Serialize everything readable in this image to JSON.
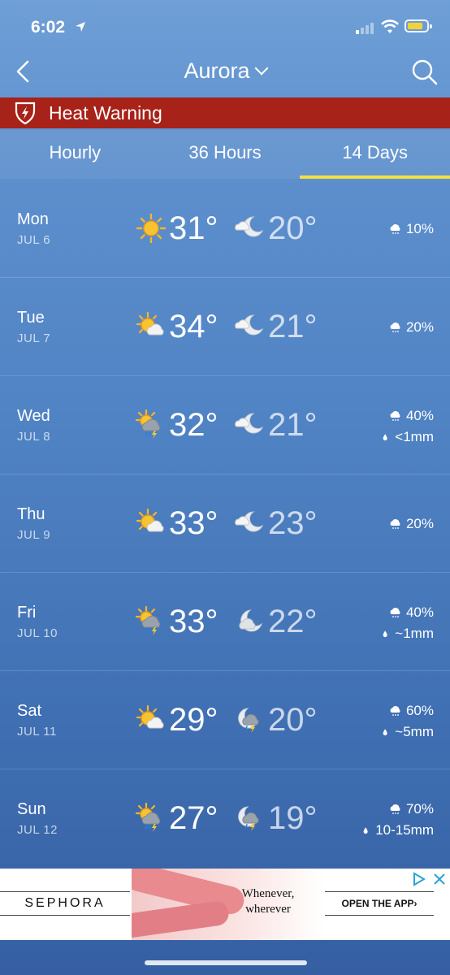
{
  "status_bar": {
    "time": "6:02"
  },
  "header": {
    "city": "Aurora"
  },
  "warning": {
    "text": "Heat Warning"
  },
  "tabs": [
    {
      "label": "Hourly",
      "active": false
    },
    {
      "label": "36 Hours",
      "active": false
    },
    {
      "label": "14 Days",
      "active": true
    }
  ],
  "forecast": [
    {
      "day": "Mon",
      "date": "JUL 6",
      "day_icon": "sunny-icon",
      "high": "31°",
      "night_icon": "moon-cloud-icon",
      "low": "20°",
      "pop": "10%",
      "amount": ""
    },
    {
      "day": "Tue",
      "date": "JUL 7",
      "day_icon": "mostly-sunny-icon",
      "high": "34°",
      "night_icon": "moon-cloud-icon",
      "low": "21°",
      "pop": "20%",
      "amount": ""
    },
    {
      "day": "Wed",
      "date": "JUL 8",
      "day_icon": "sun-thunderstorm-icon",
      "high": "32°",
      "night_icon": "moon-cloud-icon",
      "low": "21°",
      "pop": "40%",
      "amount": "<1mm"
    },
    {
      "day": "Thu",
      "date": "JUL 9",
      "day_icon": "mostly-sunny-icon",
      "high": "33°",
      "night_icon": "moon-cloud-icon",
      "low": "23°",
      "pop": "20%",
      "amount": ""
    },
    {
      "day": "Fri",
      "date": "JUL 10",
      "day_icon": "sun-thunderstorm-icon",
      "high": "33°",
      "night_icon": "cloudy-moon-icon",
      "low": "22°",
      "pop": "40%",
      "amount": "~1mm"
    },
    {
      "day": "Sat",
      "date": "JUL 11",
      "day_icon": "mostly-sunny-icon",
      "high": "29°",
      "night_icon": "moon-thunderstorm-icon",
      "low": "20°",
      "pop": "60%",
      "amount": "~5mm"
    },
    {
      "day": "Sun",
      "date": "JUL 12",
      "day_icon": "sun-thunderstorm-icon",
      "high": "27°",
      "night_icon": "moon-thunderstorm-icon",
      "low": "19°",
      "pop": "70%",
      "amount": "10-15mm"
    }
  ],
  "ad": {
    "brand": "SEPHORA",
    "tagline_line1": "Whenever,",
    "tagline_line2": "wherever",
    "cta": "OPEN THE APP›"
  },
  "colors": {
    "warning_bg": "#a72218",
    "active_tab_underline": "#f4e040",
    "battery": "#f2d13b"
  }
}
